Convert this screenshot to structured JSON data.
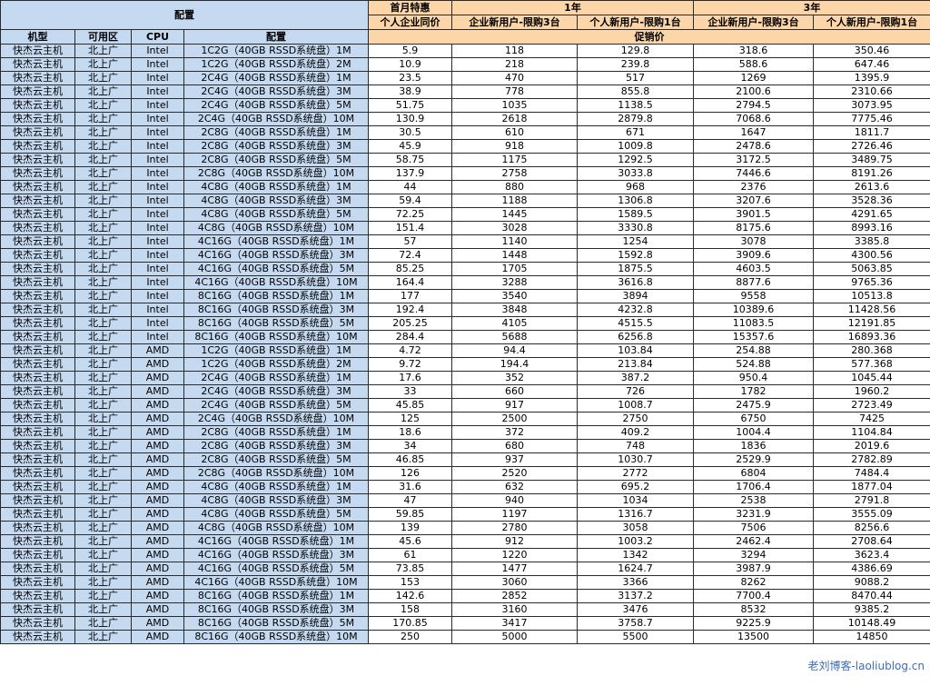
{
  "header": {
    "config_title": "配置",
    "first_month": "首月特惠",
    "one_year": "1年",
    "three_year": "3年",
    "personal_same_price": "个人企业同价",
    "enterprise_new": "企业新用户-限购3台",
    "personal_new": "个人新用户-限购1台",
    "enterprise_new_3y": "企业新用户-限购3台",
    "personal_new_3y": "个人新用户-限购1台",
    "promo_price": "促销价",
    "col_model": "机型",
    "col_zone": "可用区",
    "col_cpu": "CPU",
    "col_config": "配置"
  },
  "rows": [
    [
      "快杰云主机",
      "北上广",
      "Intel",
      "1C2G（40GB RSSD系统盘）1M",
      "5.9",
      "118",
      "129.8",
      "318.6",
      "350.46"
    ],
    [
      "快杰云主机",
      "北上广",
      "Intel",
      "1C2G（40GB RSSD系统盘）2M",
      "10.9",
      "218",
      "239.8",
      "588.6",
      "647.46"
    ],
    [
      "快杰云主机",
      "北上广",
      "Intel",
      "2C4G（40GB RSSD系统盘）1M",
      "23.5",
      "470",
      "517",
      "1269",
      "1395.9"
    ],
    [
      "快杰云主机",
      "北上广",
      "Intel",
      "2C4G（40GB RSSD系统盘）3M",
      "38.9",
      "778",
      "855.8",
      "2100.6",
      "2310.66"
    ],
    [
      "快杰云主机",
      "北上广",
      "Intel",
      "2C4G（40GB RSSD系统盘）5M",
      "51.75",
      "1035",
      "1138.5",
      "2794.5",
      "3073.95"
    ],
    [
      "快杰云主机",
      "北上广",
      "Intel",
      "2C4G（40GB RSSD系统盘）10M",
      "130.9",
      "2618",
      "2879.8",
      "7068.6",
      "7775.46"
    ],
    [
      "快杰云主机",
      "北上广",
      "Intel",
      "2C8G（40GB RSSD系统盘）1M",
      "30.5",
      "610",
      "671",
      "1647",
      "1811.7"
    ],
    [
      "快杰云主机",
      "北上广",
      "Intel",
      "2C8G（40GB RSSD系统盘）3M",
      "45.9",
      "918",
      "1009.8",
      "2478.6",
      "2726.46"
    ],
    [
      "快杰云主机",
      "北上广",
      "Intel",
      "2C8G（40GB RSSD系统盘）5M",
      "58.75",
      "1175",
      "1292.5",
      "3172.5",
      "3489.75"
    ],
    [
      "快杰云主机",
      "北上广",
      "Intel",
      "2C8G（40GB RSSD系统盘）10M",
      "137.9",
      "2758",
      "3033.8",
      "7446.6",
      "8191.26"
    ],
    [
      "快杰云主机",
      "北上广",
      "Intel",
      "4C8G（40GB RSSD系统盘）1M",
      "44",
      "880",
      "968",
      "2376",
      "2613.6"
    ],
    [
      "快杰云主机",
      "北上广",
      "Intel",
      "4C8G（40GB RSSD系统盘）3M",
      "59.4",
      "1188",
      "1306.8",
      "3207.6",
      "3528.36"
    ],
    [
      "快杰云主机",
      "北上广",
      "Intel",
      "4C8G（40GB RSSD系统盘）5M",
      "72.25",
      "1445",
      "1589.5",
      "3901.5",
      "4291.65"
    ],
    [
      "快杰云主机",
      "北上广",
      "Intel",
      "4C8G（40GB RSSD系统盘）10M",
      "151.4",
      "3028",
      "3330.8",
      "8175.6",
      "8993.16"
    ],
    [
      "快杰云主机",
      "北上广",
      "Intel",
      "4C16G（40GB RSSD系统盘）1M",
      "57",
      "1140",
      "1254",
      "3078",
      "3385.8"
    ],
    [
      "快杰云主机",
      "北上广",
      "Intel",
      "4C16G（40GB RSSD系统盘）3M",
      "72.4",
      "1448",
      "1592.8",
      "3909.6",
      "4300.56"
    ],
    [
      "快杰云主机",
      "北上广",
      "Intel",
      "4C16G（40GB RSSD系统盘）5M",
      "85.25",
      "1705",
      "1875.5",
      "4603.5",
      "5063.85"
    ],
    [
      "快杰云主机",
      "北上广",
      "Intel",
      "4C16G（40GB RSSD系统盘）10M",
      "164.4",
      "3288",
      "3616.8",
      "8877.6",
      "9765.36"
    ],
    [
      "快杰云主机",
      "北上广",
      "Intel",
      "8C16G（40GB RSSD系统盘）1M",
      "177",
      "3540",
      "3894",
      "9558",
      "10513.8"
    ],
    [
      "快杰云主机",
      "北上广",
      "Intel",
      "8C16G（40GB RSSD系统盘）3M",
      "192.4",
      "3848",
      "4232.8",
      "10389.6",
      "11428.56"
    ],
    [
      "快杰云主机",
      "北上广",
      "Intel",
      "8C16G（40GB RSSD系统盘）5M",
      "205.25",
      "4105",
      "4515.5",
      "11083.5",
      "12191.85"
    ],
    [
      "快杰云主机",
      "北上广",
      "Intel",
      "8C16G（40GB RSSD系统盘）10M",
      "284.4",
      "5688",
      "6256.8",
      "15357.6",
      "16893.36"
    ],
    [
      "快杰云主机",
      "北上广",
      "AMD",
      "1C2G（40GB RSSD系统盘）1M",
      "4.72",
      "94.4",
      "103.84",
      "254.88",
      "280.368"
    ],
    [
      "快杰云主机",
      "北上广",
      "AMD",
      "1C2G（40GB RSSD系统盘）2M",
      "9.72",
      "194.4",
      "213.84",
      "524.88",
      "577.368"
    ],
    [
      "快杰云主机",
      "北上广",
      "AMD",
      "2C4G（40GB RSSD系统盘）1M",
      "17.6",
      "352",
      "387.2",
      "950.4",
      "1045.44"
    ],
    [
      "快杰云主机",
      "北上广",
      "AMD",
      "2C4G（40GB RSSD系统盘）3M",
      "33",
      "660",
      "726",
      "1782",
      "1960.2"
    ],
    [
      "快杰云主机",
      "北上广",
      "AMD",
      "2C4G（40GB RSSD系统盘）5M",
      "45.85",
      "917",
      "1008.7",
      "2475.9",
      "2723.49"
    ],
    [
      "快杰云主机",
      "北上广",
      "AMD",
      "2C4G（40GB RSSD系统盘）10M",
      "125",
      "2500",
      "2750",
      "6750",
      "7425"
    ],
    [
      "快杰云主机",
      "北上广",
      "AMD",
      "2C8G（40GB RSSD系统盘）1M",
      "18.6",
      "372",
      "409.2",
      "1004.4",
      "1104.84"
    ],
    [
      "快杰云主机",
      "北上广",
      "AMD",
      "2C8G（40GB RSSD系统盘）3M",
      "34",
      "680",
      "748",
      "1836",
      "2019.6"
    ],
    [
      "快杰云主机",
      "北上广",
      "AMD",
      "2C8G（40GB RSSD系统盘）5M",
      "46.85",
      "937",
      "1030.7",
      "2529.9",
      "2782.89"
    ],
    [
      "快杰云主机",
      "北上广",
      "AMD",
      "2C8G（40GB RSSD系统盘）10M",
      "126",
      "2520",
      "2772",
      "6804",
      "7484.4"
    ],
    [
      "快杰云主机",
      "北上广",
      "AMD",
      "4C8G（40GB RSSD系统盘）1M",
      "31.6",
      "632",
      "695.2",
      "1706.4",
      "1877.04"
    ],
    [
      "快杰云主机",
      "北上广",
      "AMD",
      "4C8G（40GB RSSD系统盘）3M",
      "47",
      "940",
      "1034",
      "2538",
      "2791.8"
    ],
    [
      "快杰云主机",
      "北上广",
      "AMD",
      "4C8G（40GB RSSD系统盘）5M",
      "59.85",
      "1197",
      "1316.7",
      "3231.9",
      "3555.09"
    ],
    [
      "快杰云主机",
      "北上广",
      "AMD",
      "4C8G（40GB RSSD系统盘）10M",
      "139",
      "2780",
      "3058",
      "7506",
      "8256.6"
    ],
    [
      "快杰云主机",
      "北上广",
      "AMD",
      "4C16G（40GB RSSD系统盘）1M",
      "45.6",
      "912",
      "1003.2",
      "2462.4",
      "2708.64"
    ],
    [
      "快杰云主机",
      "北上广",
      "AMD",
      "4C16G（40GB RSSD系统盘）3M",
      "61",
      "1220",
      "1342",
      "3294",
      "3623.4"
    ],
    [
      "快杰云主机",
      "北上广",
      "AMD",
      "4C16G（40GB RSSD系统盘）5M",
      "73.85",
      "1477",
      "1624.7",
      "3987.9",
      "4386.69"
    ],
    [
      "快杰云主机",
      "北上广",
      "AMD",
      "4C16G（40GB RSSD系统盘）10M",
      "153",
      "3060",
      "3366",
      "8262",
      "9088.2"
    ],
    [
      "快杰云主机",
      "北上广",
      "AMD",
      "8C16G（40GB RSSD系统盘）1M",
      "142.6",
      "2852",
      "3137.2",
      "7700.4",
      "8470.44"
    ],
    [
      "快杰云主机",
      "北上广",
      "AMD",
      "8C16G（40GB RSSD系统盘）3M",
      "158",
      "3160",
      "3476",
      "8532",
      "9385.2"
    ],
    [
      "快杰云主机",
      "北上广",
      "AMD",
      "8C16G（40GB RSSD系统盘）5M",
      "170.85",
      "3417",
      "3758.7",
      "9225.9",
      "10148.49"
    ],
    [
      "快杰云主机",
      "北上广",
      "AMD",
      "8C16G（40GB RSSD系统盘）10M",
      "250",
      "5000",
      "5500",
      "13500",
      "14850"
    ]
  ],
  "watermark": "老刘博客-laoliublog.cn"
}
